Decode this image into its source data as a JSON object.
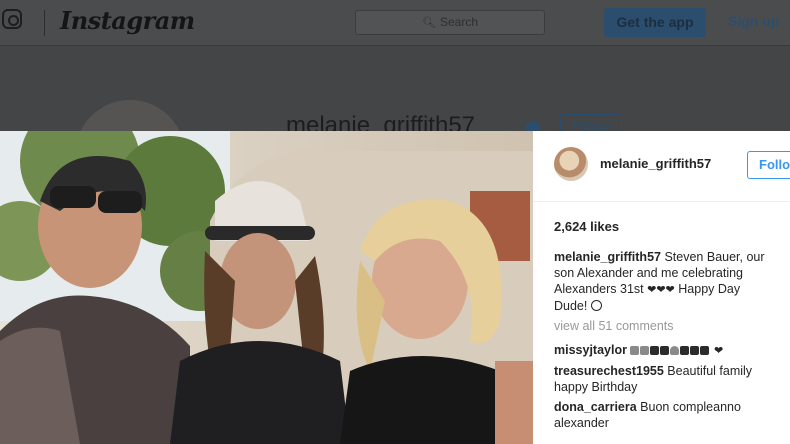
{
  "header": {
    "wordmark": "Instagram",
    "search_placeholder": "Search",
    "get_app_label": "Get the app",
    "signup_label": "Sign up"
  },
  "profile": {
    "username": "melanie_griffith57",
    "follow_label": "Follow"
  },
  "post": {
    "username": "melanie_griffith57",
    "follow_label": "Follo",
    "likes": "2,624 likes",
    "caption_user": "melanie_griffith57",
    "caption_text": "Steven Bauer, our son Alexander and me celebrating Alexanders 31st",
    "caption_hearts": "❤❤❤",
    "caption_tail": "Happy Day Dude!",
    "view_all": "view all 51 comments",
    "comments": [
      {
        "user": "missyjtaylor",
        "text": ""
      },
      {
        "user": "treasurechest1955",
        "text": "Beautiful family happy Birthday"
      },
      {
        "user": "dona_carriera",
        "text": "Buon compleanno alexander"
      }
    ],
    "missy_trailing_heart": "❤"
  },
  "icons": {
    "logo": "instagram-glyph-icon",
    "search": "search-icon",
    "verified": "verified-badge-icon",
    "caption_emoji": "wow-face-emoji-icon"
  },
  "colors": {
    "accent_blue": "#3897f0",
    "text_dark": "#262626",
    "muted_gray": "#999999"
  }
}
